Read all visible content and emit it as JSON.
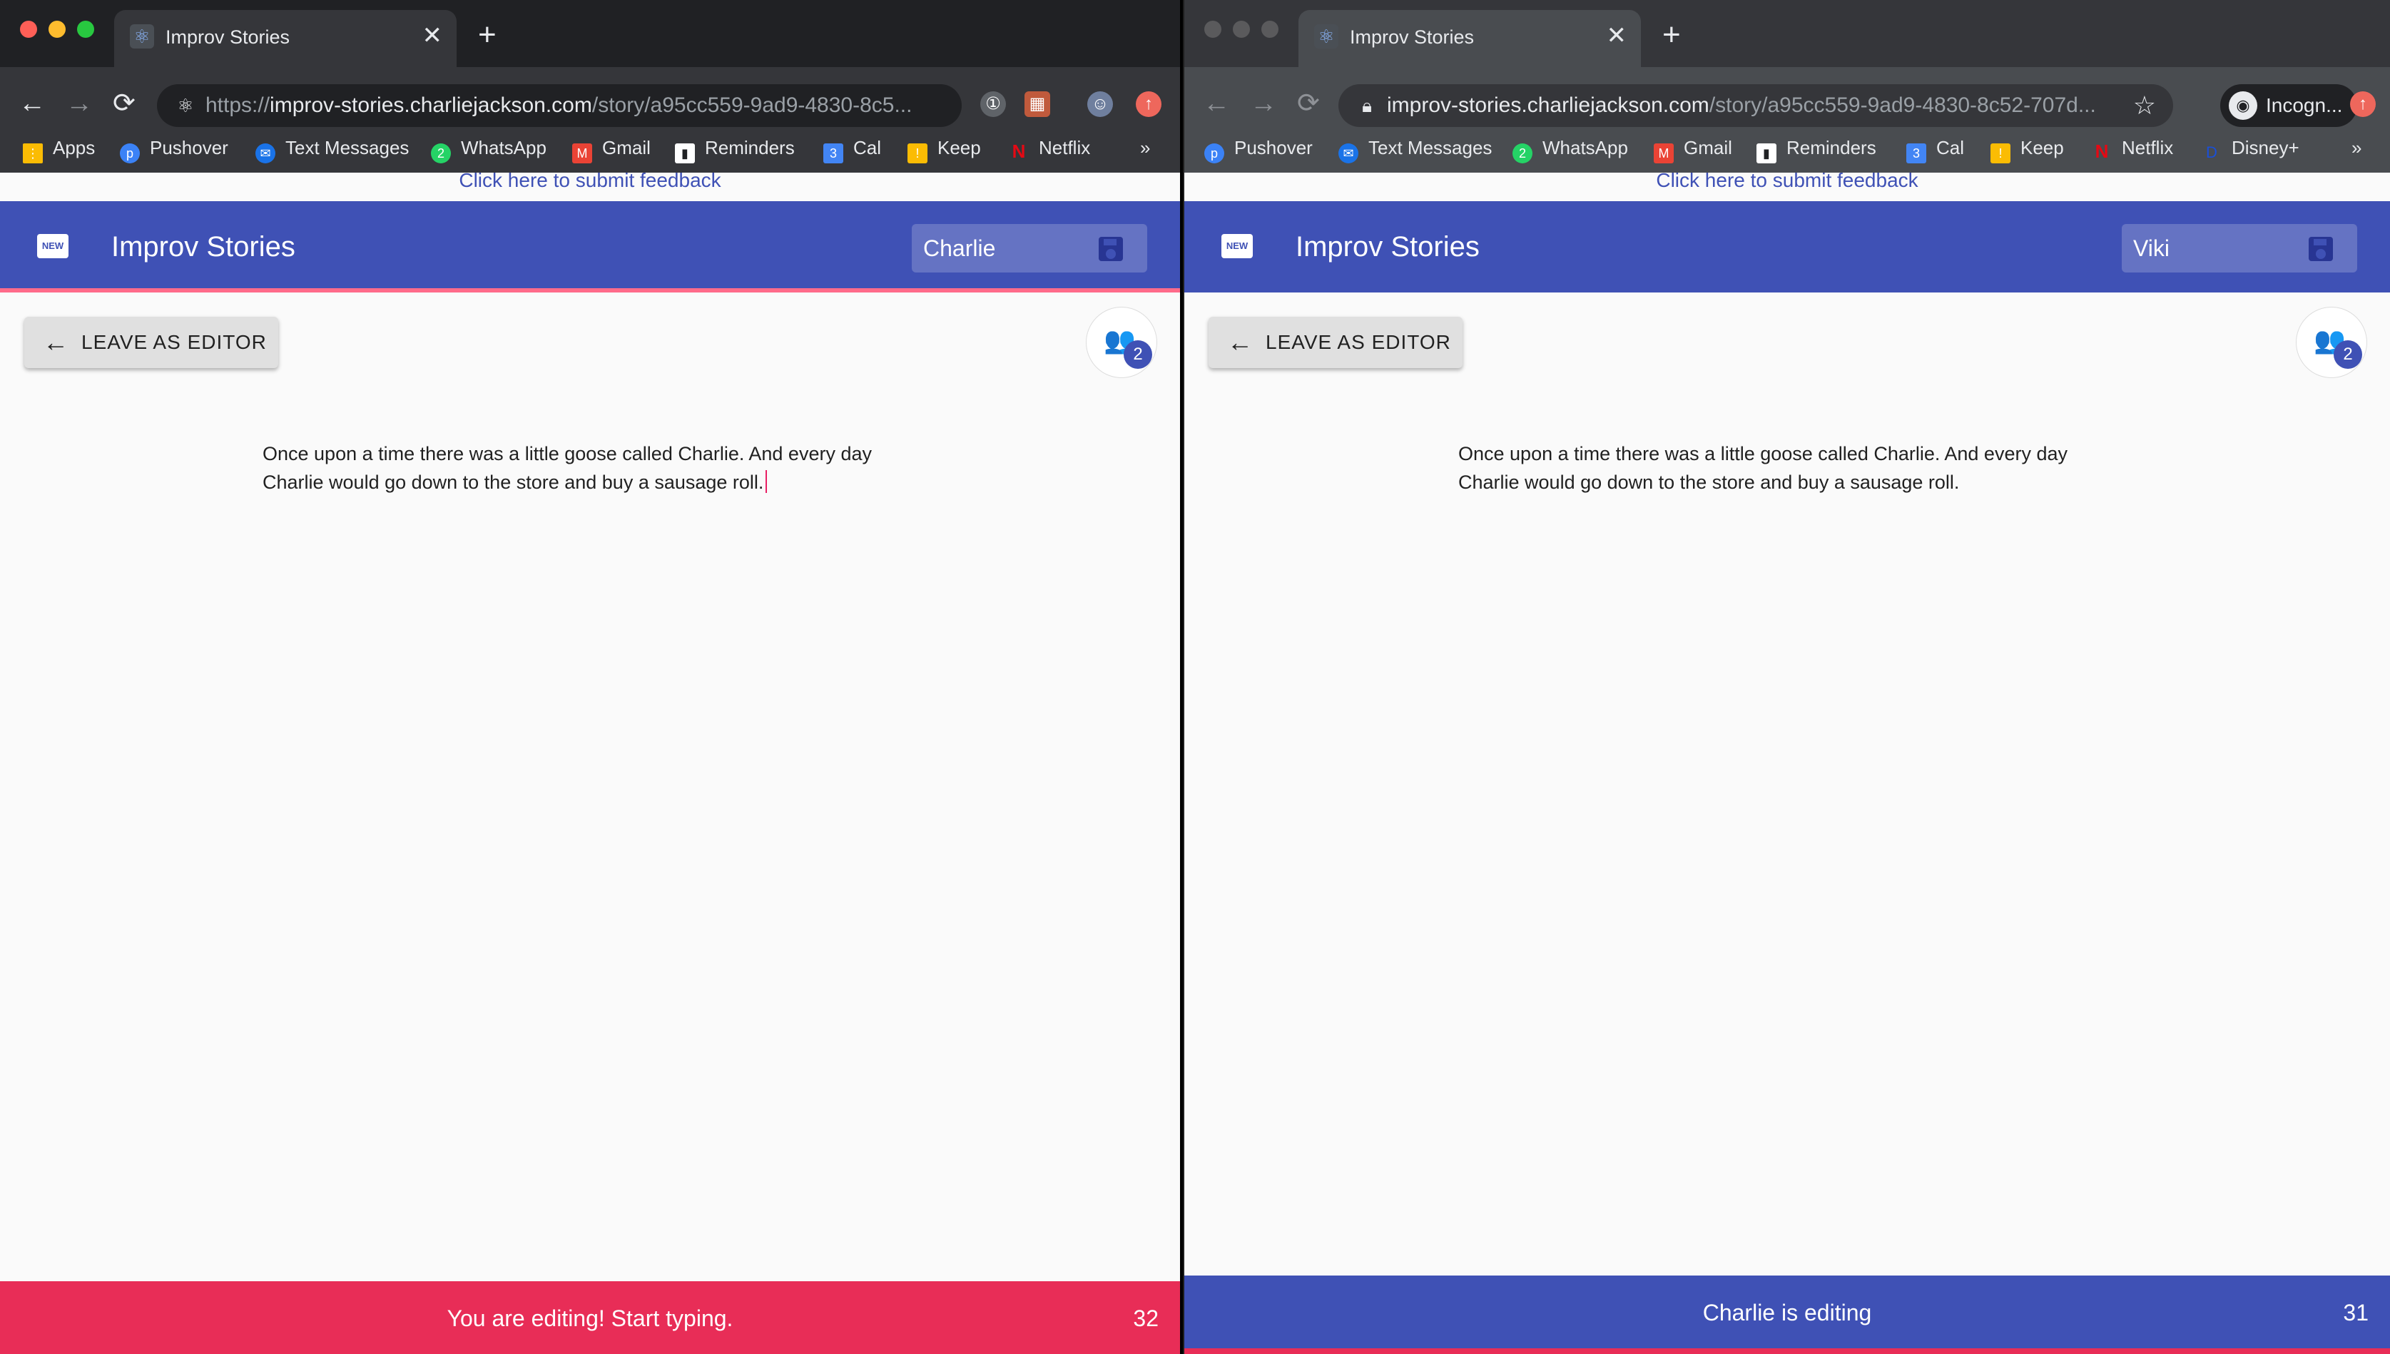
{
  "left": {
    "tab_title": "Improv Stories",
    "url_scheme": "https://",
    "url_host": "improv-stories.charliejackson.com",
    "url_path": "/story/a95cc559-9ad9-4830-8c5...",
    "bookmarks": [
      "Apps",
      "Pushover",
      "Text Messages",
      "WhatsApp",
      "Gmail",
      "Reminders",
      "Cal",
      "Keep",
      "Netflix"
    ],
    "more_bookmarks": "»",
    "feedback_link": "Click here to submit feedback",
    "app_title": "Improv Stories",
    "name_value": "Charlie",
    "leave_button": "LEAVE AS EDITOR",
    "user_count": "2",
    "story_text": "Once upon a time there was a little goose called Charlie. And every day Charlie would go down to the store and buy a sausage roll.",
    "status_message": "You are editing! Start typing.",
    "status_counter": "32"
  },
  "right": {
    "tab_title": "Improv Stories",
    "url_host": "improv-stories.charliejackson.com",
    "url_path": "/story/a95cc559-9ad9-4830-8c52-707d...",
    "incognito_label": "Incogn...",
    "bookmarks": [
      "Pushover",
      "Text Messages",
      "WhatsApp",
      "Gmail",
      "Reminders",
      "Cal",
      "Keep",
      "Netflix",
      "Disney+"
    ],
    "more_bookmarks": "»",
    "feedback_link": "Click here to submit feedback",
    "app_title": "Improv Stories",
    "name_value": "Viki",
    "leave_button": "LEAVE AS EDITOR",
    "user_count": "2",
    "story_text": "Once upon a time there was a little goose called Charlie. And every day Charlie would go down to the store and buy a sausage roll.",
    "status_message": "Charlie is editing",
    "status_counter": "31"
  },
  "icons": {
    "back": "←",
    "forward": "→",
    "reload": "⟳",
    "close": "✕",
    "new_tab": "+",
    "star": "☆",
    "more": "»"
  },
  "colors": {
    "app_primary": "#3f51b5",
    "editing_status": "#e82d57",
    "feedback_link": "#3f51b5"
  }
}
